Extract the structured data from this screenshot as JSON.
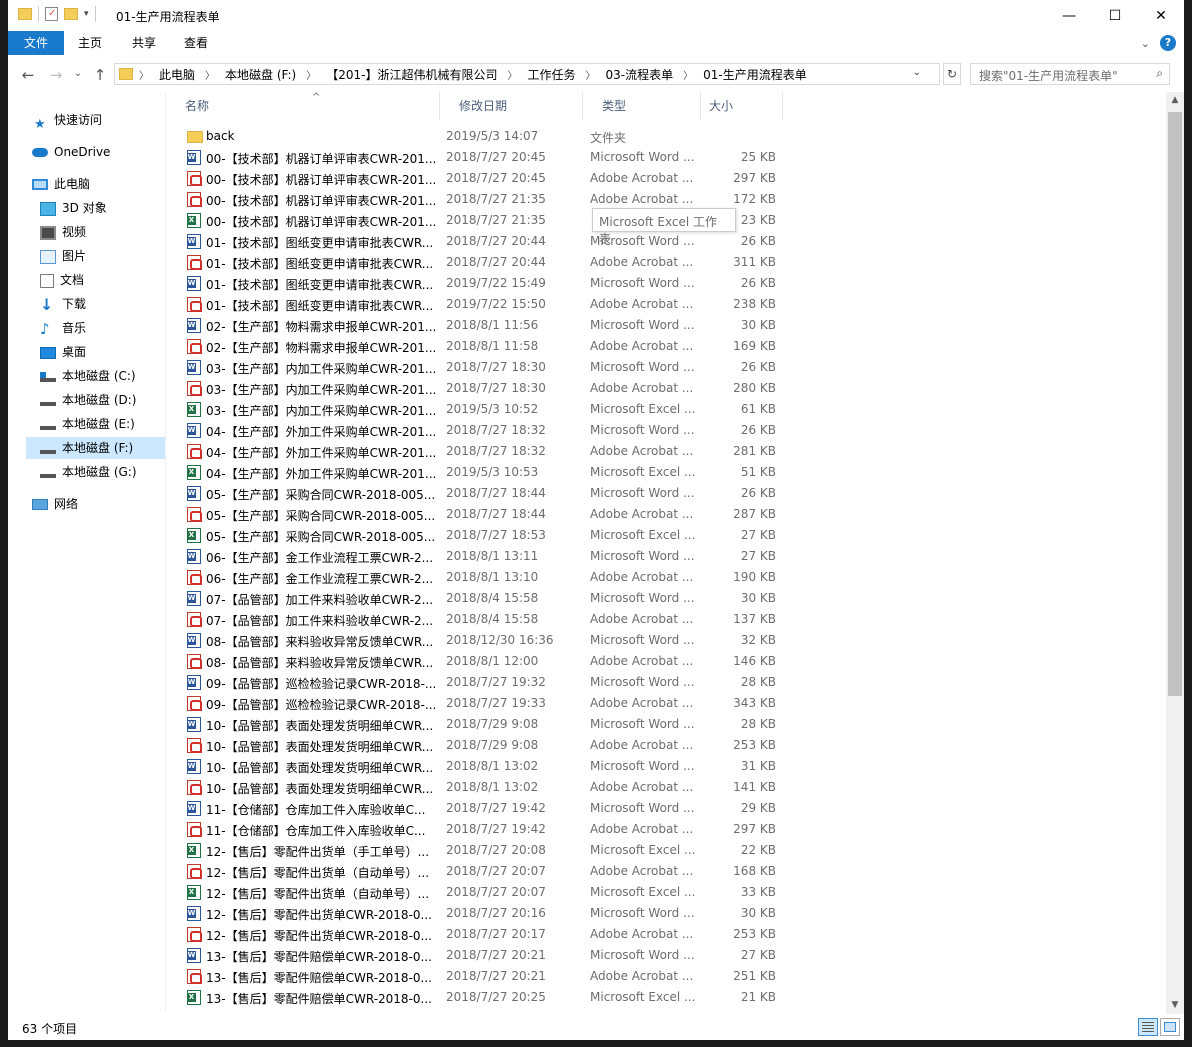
{
  "window": {
    "title": "01-生产用流程表单",
    "controls": {
      "minimize": "—",
      "maximize": "☐",
      "close": "✕"
    }
  },
  "ribbon": {
    "tabs": [
      "文件",
      "主页",
      "共享",
      "查看"
    ],
    "expand": "⌄",
    "help": "?"
  },
  "nav": {
    "back": "←",
    "forward": "→",
    "recent": "⌄",
    "up": "↑"
  },
  "address": {
    "crumbs": [
      "此电脑",
      "本地磁盘 (F:)",
      "【201-】浙江超伟机械有限公司",
      "工作任务",
      "03-流程表单",
      "01-生产用流程表单"
    ],
    "refresh": "↻"
  },
  "search": {
    "placeholder": "搜索\"01-生产用流程表单\""
  },
  "sidebar": {
    "items": [
      {
        "label": "快速访问",
        "icon": "star-icon"
      },
      {
        "label": "OneDrive",
        "icon": "cloud-icon"
      },
      {
        "label": "此电脑",
        "icon": "computer-icon"
      },
      {
        "label": "3D 对象",
        "icon": "cube-icon"
      },
      {
        "label": "视频",
        "icon": "video-icon"
      },
      {
        "label": "图片",
        "icon": "picture-icon"
      },
      {
        "label": "文档",
        "icon": "document-icon"
      },
      {
        "label": "下载",
        "icon": "download-icon"
      },
      {
        "label": "音乐",
        "icon": "music-icon"
      },
      {
        "label": "桌面",
        "icon": "desktop-icon"
      },
      {
        "label": "本地磁盘 (C:)",
        "icon": "drive-icon"
      },
      {
        "label": "本地磁盘 (D:)",
        "icon": "drive-icon"
      },
      {
        "label": "本地磁盘 (E:)",
        "icon": "drive-icon"
      },
      {
        "label": "本地磁盘 (F:)",
        "icon": "drive-icon"
      },
      {
        "label": "本地磁盘 (G:)",
        "icon": "drive-icon"
      },
      {
        "label": "网络",
        "icon": "network-icon"
      }
    ]
  },
  "columns": {
    "name": "名称",
    "date": "修改日期",
    "type": "类型",
    "size": "大小"
  },
  "tooltip": "Microsoft Excel 工作表",
  "files": [
    {
      "kind": "folder",
      "name": "back",
      "date": "2019/5/3 14:07",
      "type": "文件夹",
      "size": ""
    },
    {
      "kind": "word",
      "name": "00-【技术部】机器订单评审表CWR-201...",
      "date": "2018/7/27 20:45",
      "type": "Microsoft Word ...",
      "size": "25 KB"
    },
    {
      "kind": "pdf",
      "name": "00-【技术部】机器订单评审表CWR-201...",
      "date": "2018/7/27 20:45",
      "type": "Adobe Acrobat ...",
      "size": "297 KB"
    },
    {
      "kind": "pdf",
      "name": "00-【技术部】机器订单评审表CWR-201...",
      "date": "2018/7/27 21:35",
      "type": "Adobe Acrobat ...",
      "size": "172 KB"
    },
    {
      "kind": "xls",
      "name": "00-【技术部】机器订单评审表CWR-201...",
      "date": "2018/7/27 21:35",
      "type": "",
      "size": "23 KB"
    },
    {
      "kind": "word",
      "name": "01-【技术部】图纸变更申请审批表CWR...",
      "date": "2018/7/27 20:44",
      "type": "Microsoft Word ...",
      "size": "26 KB"
    },
    {
      "kind": "pdf",
      "name": "01-【技术部】图纸变更申请审批表CWR...",
      "date": "2018/7/27 20:44",
      "type": "Adobe Acrobat ...",
      "size": "311 KB"
    },
    {
      "kind": "word",
      "name": "01-【技术部】图纸变更申请审批表CWR...",
      "date": "2019/7/22 15:49",
      "type": "Microsoft Word ...",
      "size": "26 KB"
    },
    {
      "kind": "pdf",
      "name": "01-【技术部】图纸变更申请审批表CWR...",
      "date": "2019/7/22 15:50",
      "type": "Adobe Acrobat ...",
      "size": "238 KB"
    },
    {
      "kind": "word",
      "name": "02-【生产部】物料需求申报单CWR-201...",
      "date": "2018/8/1 11:56",
      "type": "Microsoft Word ...",
      "size": "30 KB"
    },
    {
      "kind": "pdf",
      "name": "02-【生产部】物料需求申报单CWR-201...",
      "date": "2018/8/1 11:58",
      "type": "Adobe Acrobat ...",
      "size": "169 KB"
    },
    {
      "kind": "word",
      "name": "03-【生产部】内加工件采购单CWR-201...",
      "date": "2018/7/27 18:30",
      "type": "Microsoft Word ...",
      "size": "26 KB"
    },
    {
      "kind": "pdf",
      "name": "03-【生产部】内加工件采购单CWR-201...",
      "date": "2018/7/27 18:30",
      "type": "Adobe Acrobat ...",
      "size": "280 KB"
    },
    {
      "kind": "xls",
      "name": "03-【生产部】内加工件采购单CWR-201...",
      "date": "2019/5/3 10:52",
      "type": "Microsoft Excel ...",
      "size": "61 KB"
    },
    {
      "kind": "word",
      "name": "04-【生产部】外加工件采购单CWR-201...",
      "date": "2018/7/27 18:32",
      "type": "Microsoft Word ...",
      "size": "26 KB"
    },
    {
      "kind": "pdf",
      "name": "04-【生产部】外加工件采购单CWR-201...",
      "date": "2018/7/27 18:32",
      "type": "Adobe Acrobat ...",
      "size": "281 KB"
    },
    {
      "kind": "xls",
      "name": "04-【生产部】外加工件采购单CWR-201...",
      "date": "2019/5/3 10:53",
      "type": "Microsoft Excel ...",
      "size": "51 KB"
    },
    {
      "kind": "word",
      "name": "05-【生产部】采购合同CWR-2018-005...",
      "date": "2018/7/27 18:44",
      "type": "Microsoft Word ...",
      "size": "26 KB"
    },
    {
      "kind": "pdf",
      "name": "05-【生产部】采购合同CWR-2018-005...",
      "date": "2018/7/27 18:44",
      "type": "Adobe Acrobat ...",
      "size": "287 KB"
    },
    {
      "kind": "xls",
      "name": "05-【生产部】采购合同CWR-2018-005...",
      "date": "2018/7/27 18:53",
      "type": "Microsoft Excel ...",
      "size": "27 KB"
    },
    {
      "kind": "word",
      "name": "06-【生产部】金工作业流程工票CWR-2...",
      "date": "2018/8/1 13:11",
      "type": "Microsoft Word ...",
      "size": "27 KB"
    },
    {
      "kind": "pdf",
      "name": "06-【生产部】金工作业流程工票CWR-2...",
      "date": "2018/8/1 13:10",
      "type": "Adobe Acrobat ...",
      "size": "190 KB"
    },
    {
      "kind": "word",
      "name": "07-【品管部】加工件来料验收单CWR-2...",
      "date": "2018/8/4 15:58",
      "type": "Microsoft Word ...",
      "size": "30 KB"
    },
    {
      "kind": "pdf",
      "name": "07-【品管部】加工件来料验收单CWR-2...",
      "date": "2018/8/4 15:58",
      "type": "Adobe Acrobat ...",
      "size": "137 KB"
    },
    {
      "kind": "word",
      "name": "08-【品管部】来料验收异常反馈单CWR...",
      "date": "2018/12/30 16:36",
      "type": "Microsoft Word ...",
      "size": "32 KB"
    },
    {
      "kind": "pdf",
      "name": "08-【品管部】来料验收异常反馈单CWR...",
      "date": "2018/8/1 12:00",
      "type": "Adobe Acrobat ...",
      "size": "146 KB"
    },
    {
      "kind": "word",
      "name": "09-【品管部】巡检检验记录CWR-2018-...",
      "date": "2018/7/27 19:32",
      "type": "Microsoft Word ...",
      "size": "28 KB"
    },
    {
      "kind": "pdf",
      "name": "09-【品管部】巡检检验记录CWR-2018-...",
      "date": "2018/7/27 19:33",
      "type": "Adobe Acrobat ...",
      "size": "343 KB"
    },
    {
      "kind": "word",
      "name": "10-【品管部】表面处理发货明细单CWR...",
      "date": "2018/7/29 9:08",
      "type": "Microsoft Word ...",
      "size": "28 KB"
    },
    {
      "kind": "pdf",
      "name": "10-【品管部】表面处理发货明细单CWR...",
      "date": "2018/7/29 9:08",
      "type": "Adobe Acrobat ...",
      "size": "253 KB"
    },
    {
      "kind": "word",
      "name": "10-【品管部】表面处理发货明细单CWR...",
      "date": "2018/8/1 13:02",
      "type": "Microsoft Word ...",
      "size": "31 KB"
    },
    {
      "kind": "pdf",
      "name": "10-【品管部】表面处理发货明细单CWR...",
      "date": "2018/8/1 13:02",
      "type": "Adobe Acrobat ...",
      "size": "141 KB"
    },
    {
      "kind": "word",
      "name": "11-【仓储部】仓库加工件入库验收单C...",
      "date": "2018/7/27 19:42",
      "type": "Microsoft Word ...",
      "size": "29 KB"
    },
    {
      "kind": "pdf",
      "name": "11-【仓储部】仓库加工件入库验收单C...",
      "date": "2018/7/27 19:42",
      "type": "Adobe Acrobat ...",
      "size": "297 KB"
    },
    {
      "kind": "xls",
      "name": "12-【售后】零配件出货单（手工单号）...",
      "date": "2018/7/27 20:08",
      "type": "Microsoft Excel ...",
      "size": "22 KB"
    },
    {
      "kind": "pdf",
      "name": "12-【售后】零配件出货单（自动单号）...",
      "date": "2018/7/27 20:07",
      "type": "Adobe Acrobat ...",
      "size": "168 KB"
    },
    {
      "kind": "xls",
      "name": "12-【售后】零配件出货单（自动单号）...",
      "date": "2018/7/27 20:07",
      "type": "Microsoft Excel ...",
      "size": "33 KB"
    },
    {
      "kind": "word",
      "name": "12-【售后】零配件出货单CWR-2018-0...",
      "date": "2018/7/27 20:16",
      "type": "Microsoft Word ...",
      "size": "30 KB"
    },
    {
      "kind": "pdf",
      "name": "12-【售后】零配件出货单CWR-2018-0...",
      "date": "2018/7/27 20:17",
      "type": "Adobe Acrobat ...",
      "size": "253 KB"
    },
    {
      "kind": "word",
      "name": "13-【售后】零配件赔偿单CWR-2018-0...",
      "date": "2018/7/27 20:21",
      "type": "Microsoft Word ...",
      "size": "27 KB"
    },
    {
      "kind": "pdf",
      "name": "13-【售后】零配件赔偿单CWR-2018-0...",
      "date": "2018/7/27 20:21",
      "type": "Adobe Acrobat ...",
      "size": "251 KB"
    },
    {
      "kind": "xls",
      "name": "13-【售后】零配件赔偿单CWR-2018-0...",
      "date": "2018/7/27 20:25",
      "type": "Microsoft Excel ...",
      "size": "21 KB"
    }
  ],
  "status": {
    "count": "63 个项目"
  },
  "colors": {
    "accent": "#1979ca",
    "selected": "#cce8ff",
    "header_text": "#4c607a"
  }
}
